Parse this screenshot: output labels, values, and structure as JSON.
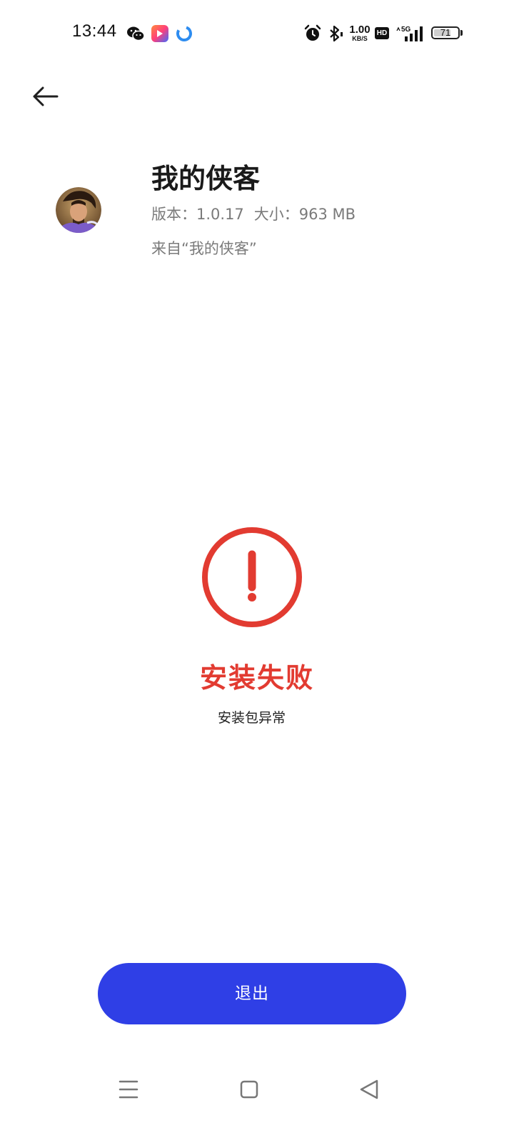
{
  "status_bar": {
    "time": "13:44",
    "net_speed_value": "1.00",
    "net_speed_unit": "KB/S",
    "hd_label": "HD",
    "network_label": "5G",
    "battery_level": "71",
    "battery_percent": 71
  },
  "app": {
    "name": "我的侠客",
    "version": "版本：1.0.17",
    "size": "大小：963 MB",
    "source": "来自“我的侠客”",
    "icon": "game-character-avatar"
  },
  "result": {
    "title": "安装失败",
    "reason": "安装包异常",
    "icon": "exclamation-circle-icon",
    "accent_color": "#e23b31"
  },
  "actions": {
    "exit_label": "退出",
    "button_color": "#2f3fe6"
  },
  "nav_bar": {
    "icons": [
      "menu-icon",
      "home-icon",
      "back-triangle-icon"
    ]
  }
}
